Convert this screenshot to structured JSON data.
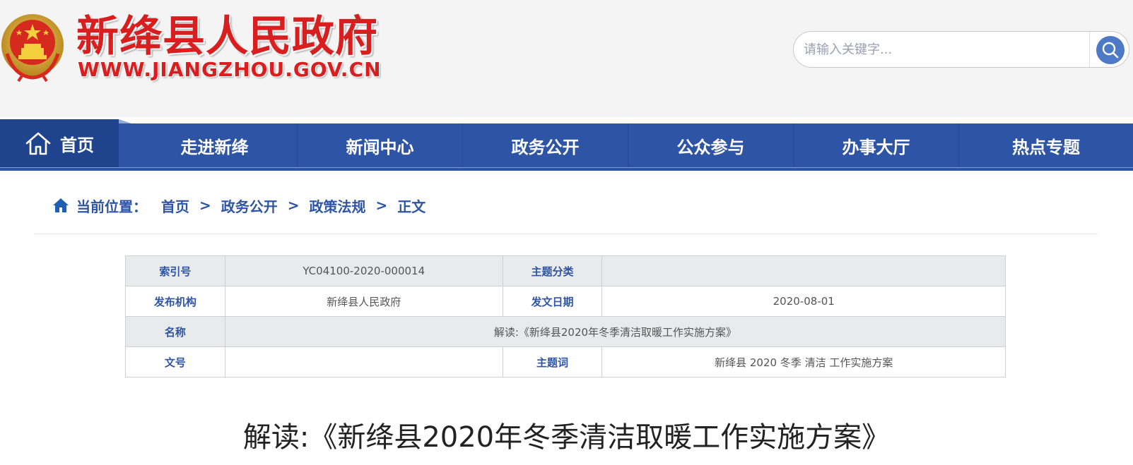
{
  "header": {
    "site_name": "新绛县人民政府",
    "site_url": "WWW.JIANGZHOU.GOV.CN",
    "search": {
      "placeholder": "请输入关键字..."
    }
  },
  "nav": {
    "items": [
      {
        "label": "首页",
        "icon": "home-icon",
        "active": true
      },
      {
        "label": "走进新绛"
      },
      {
        "label": "新闻中心"
      },
      {
        "label": "政务公开"
      },
      {
        "label": "公众参与"
      },
      {
        "label": "办事大厅"
      },
      {
        "label": "热点专题"
      }
    ]
  },
  "breadcrumb": {
    "label": "当前位置：",
    "separator": ">",
    "items": [
      "首页",
      "政务公开",
      "政策法规",
      "正文"
    ]
  },
  "info": {
    "index_no_label": "索引号",
    "index_no": "YC04100-2020-000014",
    "topic_label": "主题分类",
    "topic": "",
    "publisher_label": "发布机构",
    "publisher": "新绛县人民政府",
    "date_label": "发文日期",
    "date": "2020-08-01",
    "name_label": "名称",
    "name": "解读:《新绛县2020年冬季清洁取暖工作实施方案》",
    "doc_no_label": "文号",
    "doc_no": "",
    "keywords_label": "主题词",
    "keywords": "新绛县 2020 冬季 清洁 工作实施方案"
  },
  "article": {
    "title": "解读:《新绛县2020年冬季清洁取暖工作实施方案》"
  },
  "colors": {
    "nav_blue": "#2e55a5",
    "nav_active": "#1f438d",
    "brand_red": "#d81e1e",
    "search_button": "#4d79c7"
  }
}
